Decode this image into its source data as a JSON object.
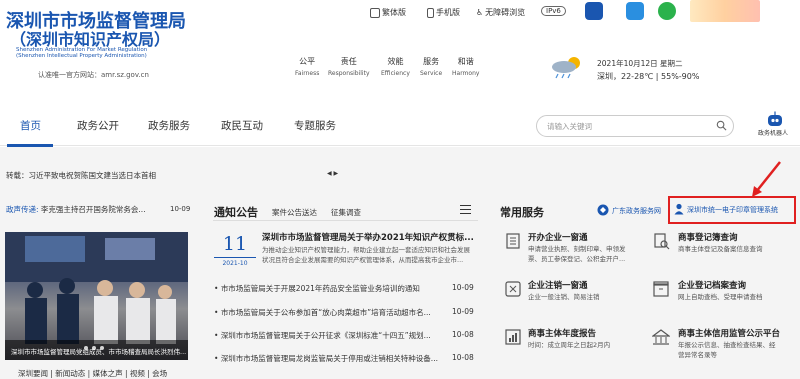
{
  "header": {
    "logo_cn_line1": "深圳市市场监督管理局",
    "logo_cn_line2": "（深圳市知识产权局）",
    "logo_en_line1": "Shenzhen Administration For Market Regulation",
    "logo_en_line2": "(Shenzhen Intellectual Property Administration)",
    "site_label": "认准唯一官方网站：amr.sz.gov.cn",
    "links": {
      "traditional": "繁体版",
      "mobile": "手机版",
      "accessible": "无障碍浏览",
      "ipv6": "IPv6"
    },
    "motto": [
      {
        "cn": "公平",
        "en": "Fairness"
      },
      {
        "cn": "责任",
        "en": "Responsibility"
      },
      {
        "cn": "效能",
        "en": "Efficiency"
      },
      {
        "cn": "服务",
        "en": "Service"
      },
      {
        "cn": "和谐",
        "en": "Harmony"
      }
    ],
    "weather": {
      "date": "2021年10月12日 星期二",
      "detail": "深圳，22-28℃  |  55%-90%"
    }
  },
  "nav": {
    "items": [
      "首页",
      "政务公开",
      "政务服务",
      "政民互动",
      "专题服务"
    ],
    "active_index": 0,
    "search_placeholder": "请输入关键词",
    "robot_label": "政务机器人"
  },
  "ticker": {
    "text": "转载：习近平致电祝贺陈国文建当选日本首相",
    "arrows": "◀ ▶"
  },
  "left": {
    "news_label": "政声传递:",
    "news_text": "李克强主持召开国务院常务会...",
    "news_date": "10-09",
    "photo_caption": "深圳市市场监督管理局党组成员、市市场稽查局局长洪烈伟...",
    "links": "深圳要闻 | 新闻动态 | 媒体之声 | 视频 | 会场"
  },
  "notices": {
    "title": "通知公告",
    "tab1": "案件公告送达",
    "tab2": "征集调查",
    "featured": {
      "day": "11",
      "month": "2021-10",
      "title": "深圳市市场监督管理局关于举办2021年知识产权贯标...",
      "summary": "为推动企业知识产权管理能力，帮助企业建立起一套适应知识和社会发展状况且符合企业发展需要的知识产权管理体系，从而提高我市企业市..."
    },
    "items": [
      {
        "text": "市市场监管局关于开展2021年药品安全监管业务培训的通知",
        "date": "10-09"
      },
      {
        "text": "市市场监管局关于公布参加首“放心肉菜超市”培育活动超市名...",
        "date": "10-09"
      },
      {
        "text": "深圳市市场监督管理局关于公开征求《深圳标准“十四五”规划...",
        "date": "10-08"
      },
      {
        "text": "深圳市市场监督管理局龙岗监管局关于停用或注销相关特种设备...",
        "date": "10-08"
      }
    ]
  },
  "services": {
    "title": "常用服务",
    "guangdong": "广东政务服务网",
    "electronic_seal": "深圳市统一电子印章管理系统",
    "items": [
      {
        "title": "开办企业一窗通",
        "desc1": "申请营业执照、刻制印章、申领发",
        "desc2": "票、员工参保登记、公积金开户..."
      },
      {
        "title": "商事登记簿查询",
        "desc1": "商事主体登记及备案信息查询",
        "desc2": ""
      },
      {
        "title": "企业注销一窗通",
        "desc1": "企业一般注销、简易注销",
        "desc2": ""
      },
      {
        "title": "企业登记档案查询",
        "desc1": "网上自助查档、受理申请查档",
        "desc2": ""
      },
      {
        "title": "商事主体年度报告",
        "desc1": "时间：成立周年之日起2月内",
        "desc2": ""
      },
      {
        "title": "商事主体信用监管公示平台",
        "desc1": "年报公示信息、抽查检查结果、经",
        "desc2": "营异常名录等"
      }
    ]
  },
  "colors": {
    "brand_blue": "#1a56b0",
    "highlight_red": "#e02020"
  }
}
